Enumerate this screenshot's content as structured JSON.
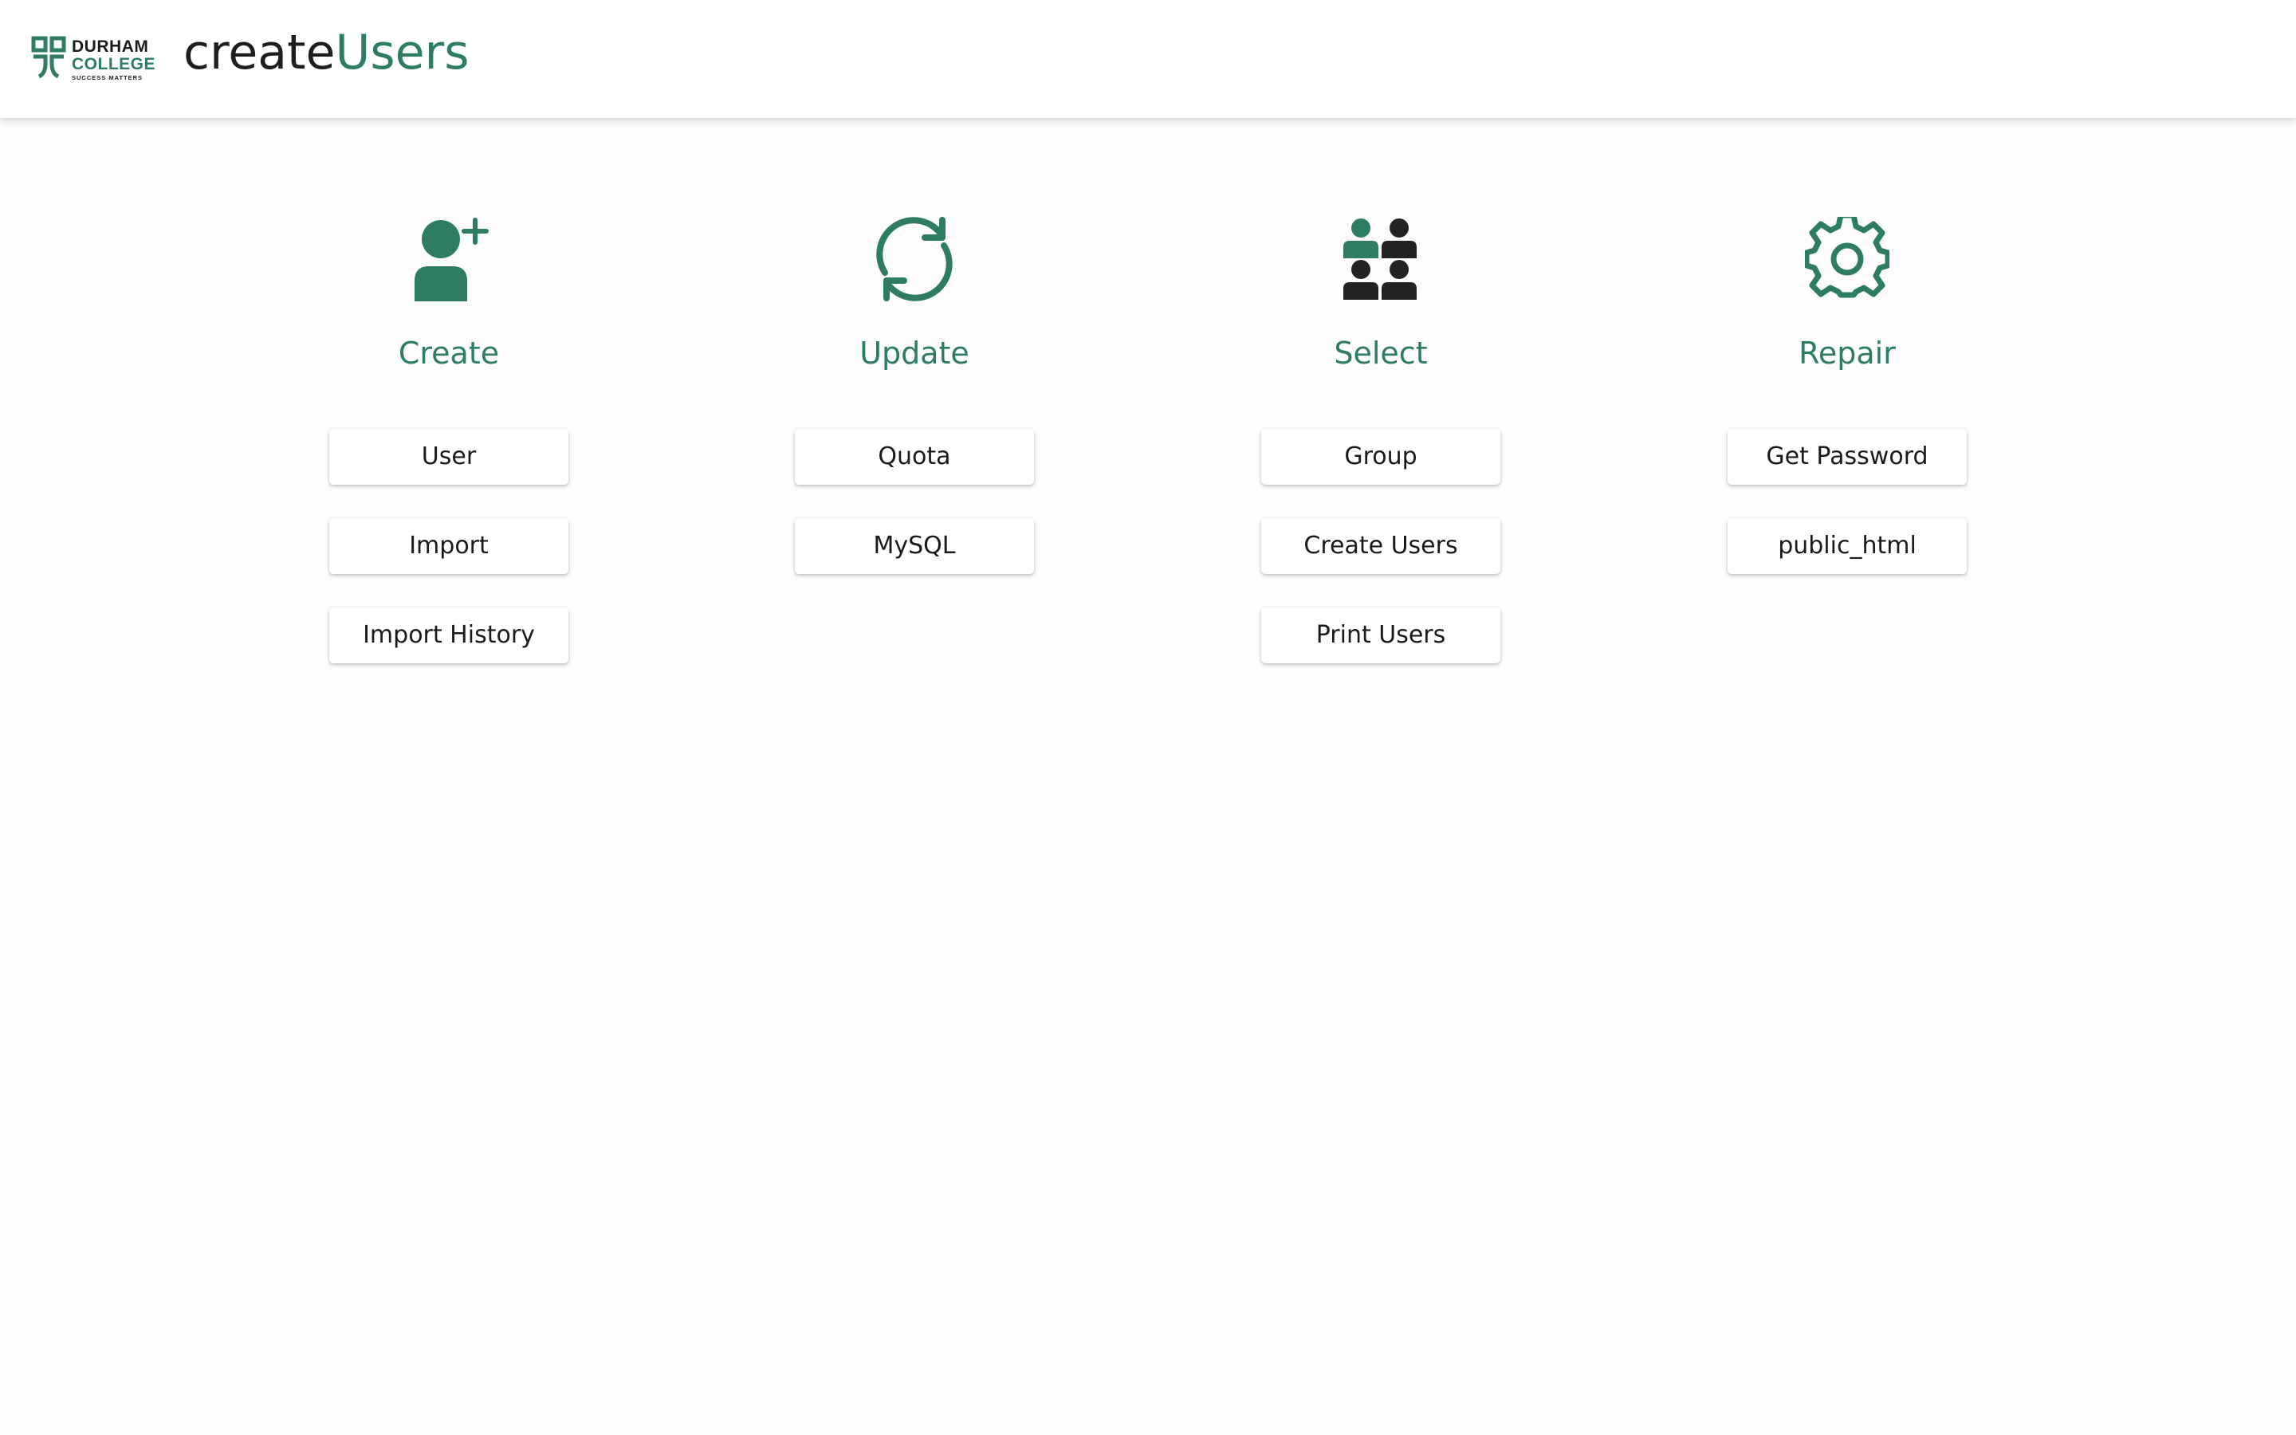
{
  "header": {
    "logo": {
      "line1": "DURHAM",
      "line2": "COLLEGE",
      "line3": "SUCCESS MATTERS"
    },
    "title_part1": "create",
    "title_part2": "Users"
  },
  "colors": {
    "accent": "#2e7d62",
    "text": "#1e1e1e",
    "background": "#fcfcfc"
  },
  "columns": [
    {
      "icon": "user-plus-icon",
      "title": "Create",
      "buttons": [
        "User",
        "Import",
        "Import History"
      ]
    },
    {
      "icon": "refresh-icon",
      "title": "Update",
      "buttons": [
        "Quota",
        "MySQL"
      ]
    },
    {
      "icon": "user-group-icon",
      "title": "Select",
      "buttons": [
        "Group",
        "Create Users",
        "Print Users"
      ]
    },
    {
      "icon": "gear-icon",
      "title": "Repair",
      "buttons": [
        "Get Password",
        "public_html"
      ]
    }
  ]
}
